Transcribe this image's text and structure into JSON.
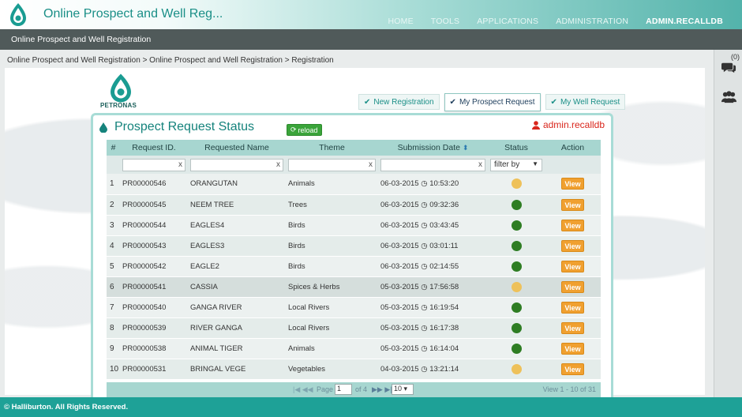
{
  "header": {
    "app_title": "Online Prospect and Well Reg...",
    "nav": [
      {
        "label": "HOME",
        "active": false
      },
      {
        "label": "TOOLS",
        "active": false
      },
      {
        "label": "APPLICATIONS",
        "active": false
      },
      {
        "label": "ADMINISTRATION",
        "active": false
      },
      {
        "label": "ADMIN.RECALLDB",
        "active": true
      }
    ],
    "logo_icon": "petronas-logo-icon"
  },
  "subbar": {
    "label": "Online Prospect and Well Registration"
  },
  "breadcrumb": "Online Prospect and Well Registration  >  Online Prospect and Well Registration  >  Registration",
  "sidepanel": {
    "count": "(0)",
    "icons": [
      "chat-icon",
      "users-icon"
    ]
  },
  "brand": {
    "text": "PETRONAS"
  },
  "tabs": [
    {
      "label": "New Registration",
      "active": false
    },
    {
      "label": "My Prospect Request",
      "active": true
    },
    {
      "label": "My Well Request",
      "active": false
    }
  ],
  "panel": {
    "title": "Prospect Request Status",
    "reload_label": "reload",
    "user": "admin.recalldb"
  },
  "table": {
    "columns": [
      "#",
      "Request ID.",
      "Requested Name",
      "Theme",
      "Submission Date",
      "Status",
      "Action"
    ],
    "filter_select": "filter by",
    "filter_clear": "x",
    "rows": [
      {
        "num": "1",
        "id": "PR00000546",
        "name": "ORANGUTAN",
        "theme": "Animals",
        "date": "06-03-2015",
        "time": "10:53:20",
        "status": "pending",
        "action": "View"
      },
      {
        "num": "2",
        "id": "PR00000545",
        "name": "NEEM TREE",
        "theme": "Trees",
        "date": "06-03-2015",
        "time": "09:32:36",
        "status": "approved",
        "action": "View"
      },
      {
        "num": "3",
        "id": "PR00000544",
        "name": "EAGLES4",
        "theme": "Birds",
        "date": "06-03-2015",
        "time": "03:43:45",
        "status": "approved",
        "action": "View"
      },
      {
        "num": "4",
        "id": "PR00000543",
        "name": "EAGLES3",
        "theme": "Birds",
        "date": "06-03-2015",
        "time": "03:01:11",
        "status": "approved",
        "action": "View"
      },
      {
        "num": "5",
        "id": "PR00000542",
        "name": "EAGLE2",
        "theme": "Birds",
        "date": "06-03-2015",
        "time": "02:14:55",
        "status": "approved",
        "action": "View"
      },
      {
        "num": "6",
        "id": "PR00000541",
        "name": "CASSIA",
        "theme": "Spices & Herbs",
        "date": "05-03-2015",
        "time": "17:56:58",
        "status": "pending",
        "action": "View"
      },
      {
        "num": "7",
        "id": "PR00000540",
        "name": "GANGA RIVER",
        "theme": "Local Rivers",
        "date": "05-03-2015",
        "time": "16:19:54",
        "status": "approved",
        "action": "View"
      },
      {
        "num": "8",
        "id": "PR00000539",
        "name": "RIVER GANGA",
        "theme": "Local Rivers",
        "date": "05-03-2015",
        "time": "16:17:38",
        "status": "approved",
        "action": "View"
      },
      {
        "num": "9",
        "id": "PR00000538",
        "name": "ANIMAL TIGER",
        "theme": "Animals",
        "date": "05-03-2015",
        "time": "16:14:04",
        "status": "approved",
        "action": "View"
      },
      {
        "num": "10",
        "id": "PR00000531",
        "name": "BRINGAL VEGE",
        "theme": "Vegetables",
        "date": "04-03-2015",
        "time": "13:21:14",
        "status": "pending",
        "action": "View"
      }
    ],
    "highlight_row": 6
  },
  "pager": {
    "first_prev": "|◀  ◀◀",
    "page_label": "Page",
    "page_value": "1",
    "of_label": "of 4",
    "next_last": "▶▶  ▶|",
    "rows_per_page": "10",
    "view_info": "View 1 - 10 of 31"
  },
  "status_colors": {
    "approved": "#2e7d23",
    "pending": "#eec15a"
  },
  "footer": {
    "text": "© Halliburton. All Rights Reserved."
  }
}
